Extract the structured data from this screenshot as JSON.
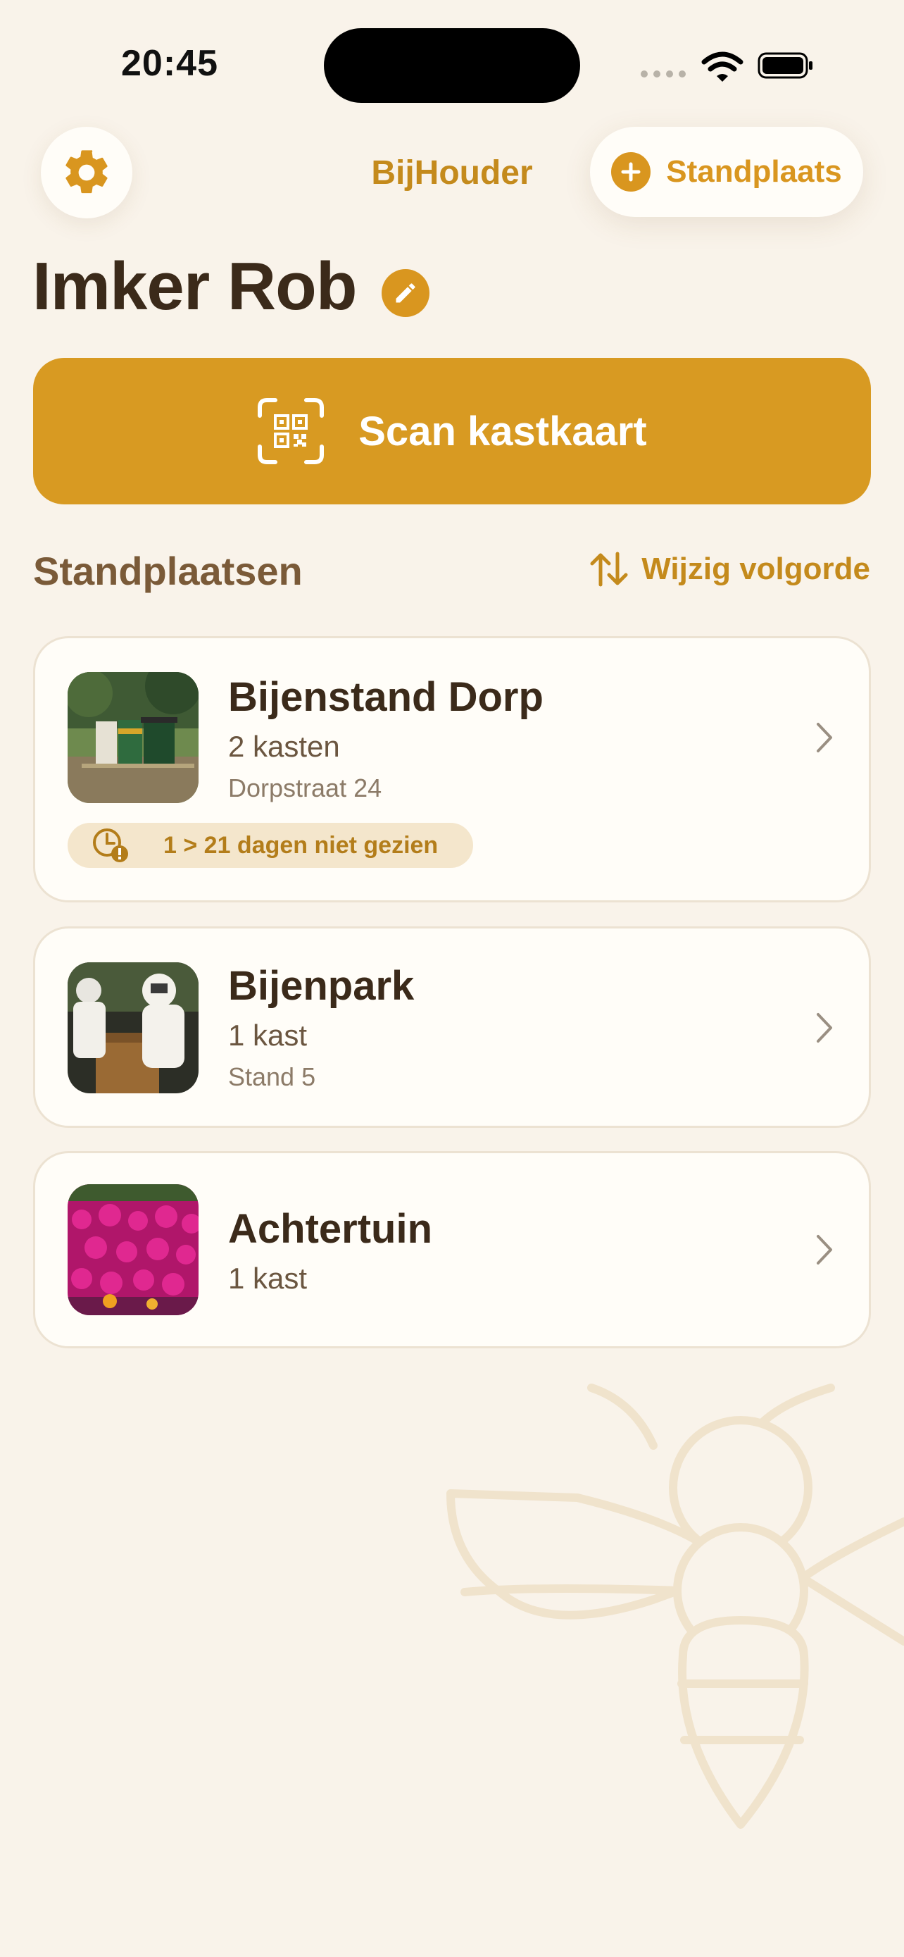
{
  "status_bar": {
    "time": "20:45"
  },
  "nav": {
    "app_title": "BijHouder",
    "add_label": "Standplaats"
  },
  "header": {
    "user_name": "Imker Rob"
  },
  "scan_button": {
    "label": "Scan kastkaart"
  },
  "section": {
    "title": "Standplaatsen",
    "reorder_label": "Wijzig volgorde"
  },
  "locations": [
    {
      "name": "Bijenstand Dorp",
      "count": "2 kasten",
      "address": "Dorpstraat 24",
      "badge": "1 > 21 dagen niet gezien"
    },
    {
      "name": "Bijenpark",
      "count": "1 kast",
      "address": "Stand 5"
    },
    {
      "name": "Achtertuin",
      "count": "1 kast"
    }
  ],
  "colors": {
    "accent": "#d9961f",
    "background": "#f9f3ea",
    "card": "#fffdf8",
    "text": "#3b2a1a"
  },
  "icons": [
    "gear-icon",
    "plus-icon",
    "pencil-icon",
    "qr-scan-icon",
    "sort-arrows-icon",
    "chevron-right-icon",
    "clock-alert-icon",
    "bee-watermark-icon"
  ]
}
